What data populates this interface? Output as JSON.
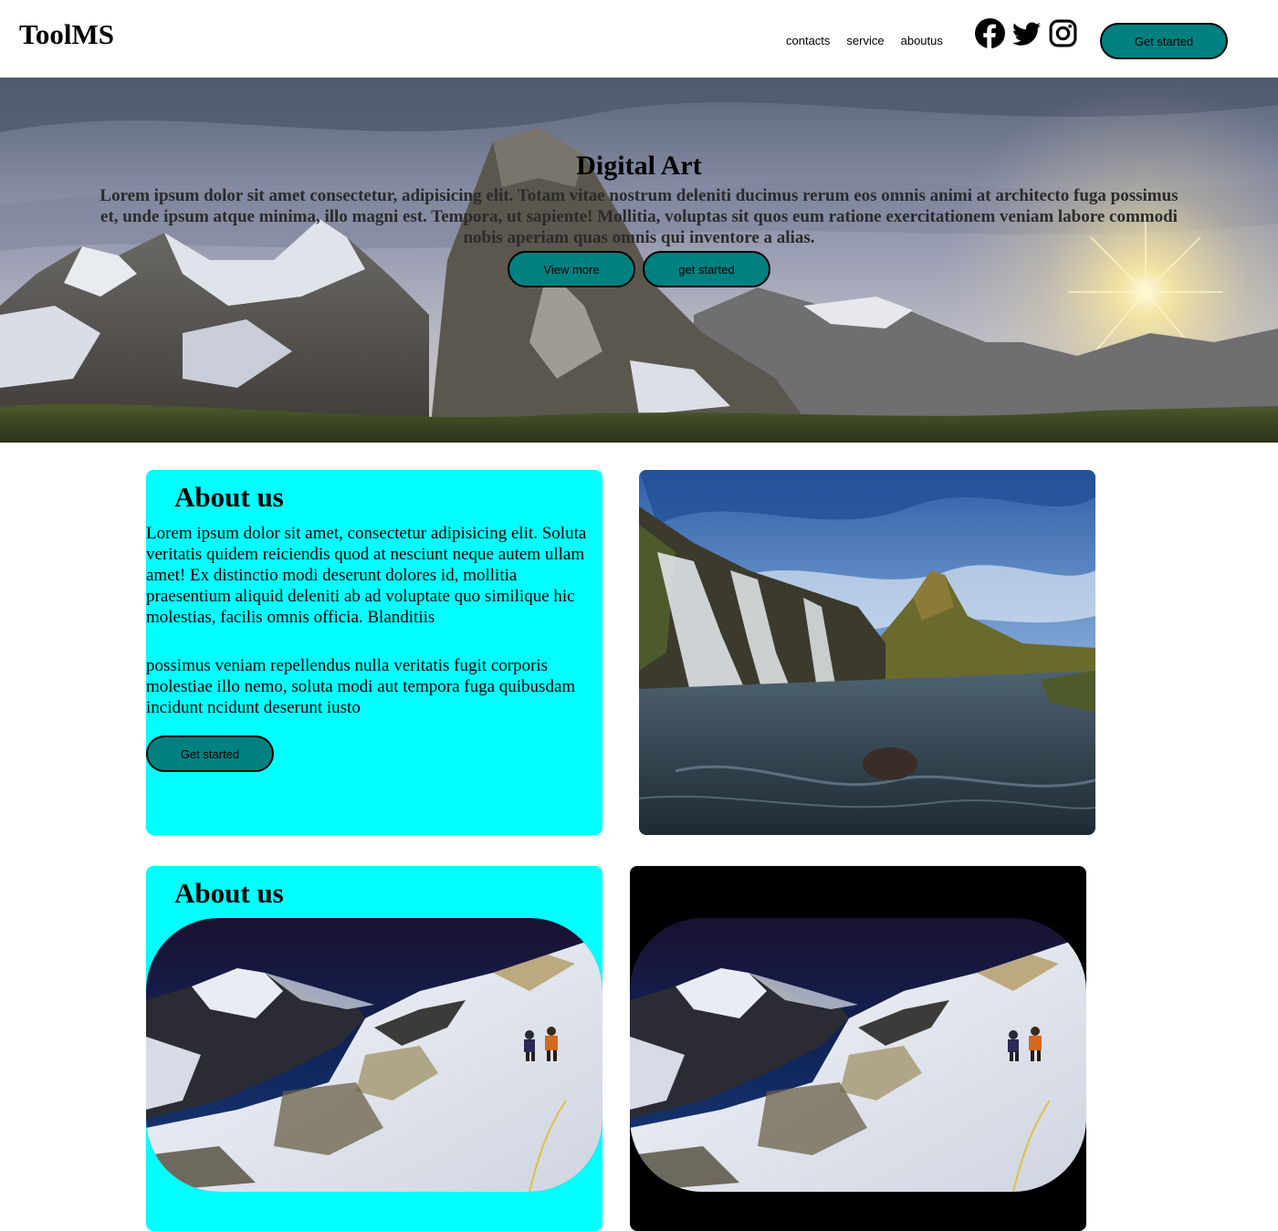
{
  "header": {
    "logo": "ToolMS",
    "nav": [
      {
        "label": "contacts"
      },
      {
        "label": "service"
      },
      {
        "label": "aboutus"
      }
    ],
    "socials": [
      {
        "icon": "facebook-icon"
      },
      {
        "icon": "twitter-icon"
      },
      {
        "icon": "instagram-icon"
      }
    ],
    "cta_label": "Get started"
  },
  "hero": {
    "title": "Digital Art",
    "text": "Lorem ipsum dolor sit amet consectetur, adipisicing elit. Totam vitae nostrum deleniti ducimus rerum eos omnis animi at architecto fuga possimus et, unde ipsum atque minima, illo magni est. Tempora, ut sapiente! Mollitia, voluptas sit quos eum ratione exercitationem veniam labore commodi nobis aperiam quas omnis qui inventore a alias.",
    "view_more_label": "View more",
    "get_started_label": "get started"
  },
  "about_section": {
    "title": "About us",
    "paragraph1": "Lorem ipsum dolor sit amet, consectetur adipisicing elit. Soluta veritatis quidem reiciendis quod at nesciunt neque autem ullam amet! Ex distinctio modi deserunt dolores id, mollitia praesentium aliquid deleniti ab ad voluptate quo similique hic molestias, facilis omnis officia. Blanditiis",
    "paragraph2": "possimus veniam repellendus nulla veritatis fugit corporis molestiae illo nemo, soluta modi aut tempora fuga quibusdam incidunt ncidunt deserunt iusto",
    "button_label": "Get started"
  },
  "gallery_section": {
    "title": "About us"
  },
  "colors": {
    "accent": "#008080",
    "card_bg": "#00ffff",
    "dark_card_bg": "#000000"
  }
}
